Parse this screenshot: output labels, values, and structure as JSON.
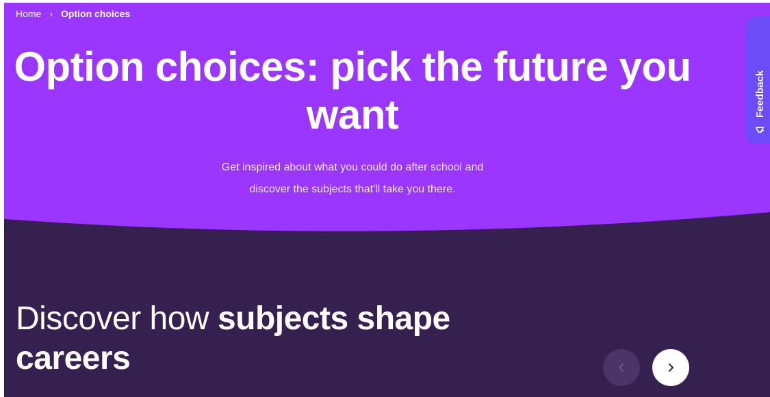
{
  "breadcrumb": {
    "home": "Home",
    "separator": ">",
    "current": "Option choices"
  },
  "hero": {
    "title": "Option choices: pick the future you want",
    "subtitle_line1": "Get inspired about what you could do after school and",
    "subtitle_line2": "discover the subjects that'll take you there."
  },
  "feedback": {
    "label": "Feedback",
    "icon": "megaphone-icon"
  },
  "section": {
    "title_light": "Discover how ",
    "title_bold": "subjects shape careers"
  },
  "carousel": {
    "prev_icon": "chevron-left-icon",
    "next_icon": "chevron-right-icon"
  },
  "colors": {
    "hero_bg": "#9b36ff",
    "dark_bg": "#36204f",
    "feedback_bg": "#6b4cf6",
    "white": "#ffffff"
  }
}
